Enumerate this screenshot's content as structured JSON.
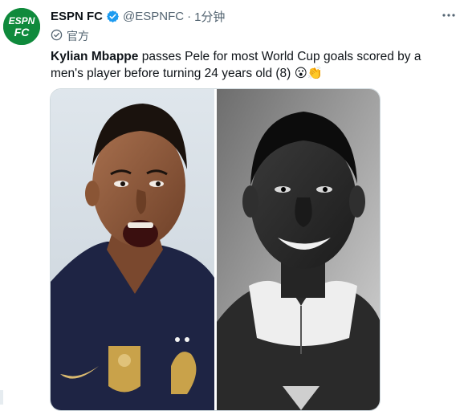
{
  "account": {
    "display_name": "ESPN FC",
    "handle": "@ESPNFC",
    "separator": "·",
    "time": "1分钟",
    "official_label": "官方",
    "avatar_text": [
      "ESPN",
      "FC"
    ]
  },
  "tweet": {
    "bold_text": "Kylian Mbappe",
    "text": " passes Pele for most World Cup goals scored by a men's player before turning 24 years old (8) 😮👏"
  },
  "media": {
    "left_photo": "mbappe-photo",
    "right_photo": "pele-photo"
  },
  "colors": {
    "avatar_green": "#0f8a3c",
    "verified_blue": "#1d9bf0",
    "france_navy": "#1e2444",
    "gold": "#c9a24a"
  }
}
